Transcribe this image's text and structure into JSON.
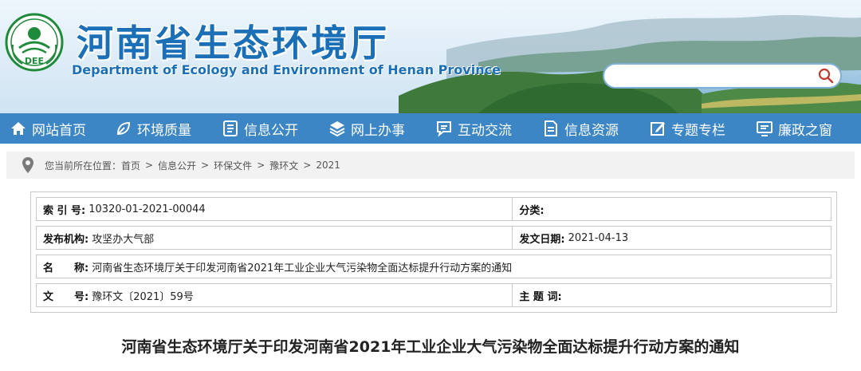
{
  "header": {
    "title": "河南省生态环境厅",
    "subtitle": "Department of Ecology and Environment of Henan Province",
    "logo_text": "DEE",
    "search": {
      "value": "",
      "placeholder": ""
    }
  },
  "nav": {
    "items": [
      {
        "label": "网站首页",
        "icon": "home-icon"
      },
      {
        "label": "环境质量",
        "icon": "leaf-icon"
      },
      {
        "label": "信息公开",
        "icon": "document-icon"
      },
      {
        "label": "网上办事",
        "icon": "layers-icon"
      },
      {
        "label": "互动交流",
        "icon": "chat-icon"
      },
      {
        "label": "信息资源",
        "icon": "file-icon"
      },
      {
        "label": "专题专栏",
        "icon": "edit-icon"
      },
      {
        "label": "廉政之窗",
        "icon": "monitor-icon"
      }
    ]
  },
  "breadcrumb": {
    "prefix": "您当前所在位置：",
    "items": [
      "首页",
      "信息公开",
      "环保文件",
      "豫环文",
      "2021"
    ],
    "separator": ">"
  },
  "info": {
    "index_label": "索 引 号:",
    "index_value": "10320-01-2021-00044",
    "category_label": "分类:",
    "category_value": "",
    "publisher_label": "发布机构:",
    "publisher_value": "攻坚办大气部",
    "date_label": "发文日期:",
    "date_value": "2021-04-13",
    "name_label": "名　　称:",
    "name_value": "河南省生态环境厅关于印发河南省2021年工业企业大气污染物全面达标提升行动方案的通知",
    "docno_label": "文　　号:",
    "docno_value": "豫环文〔2021〕59号",
    "subject_label": "主 题 词:",
    "subject_value": ""
  },
  "document": {
    "title": "河南省生态环境厅关于印发河南省2021年工业企业大气污染物全面达标提升行动方案的通知"
  },
  "colors": {
    "nav_bg": "#3d86c6",
    "title_blue": "#1a6fb6",
    "logo_green": "#1e8b3a"
  }
}
